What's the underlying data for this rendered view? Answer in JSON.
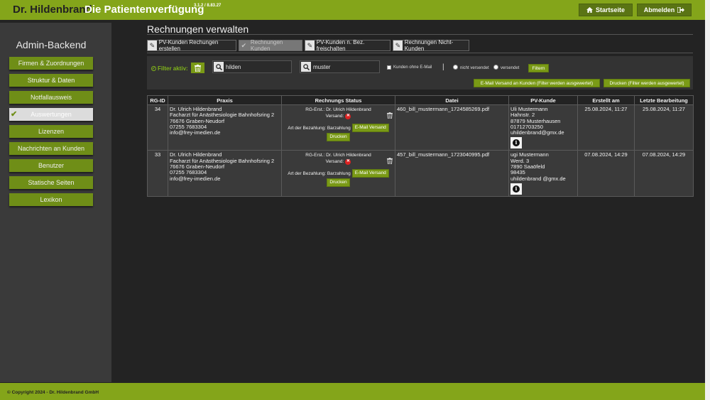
{
  "header": {
    "brand": "Dr. Hildenbrand",
    "app_name": "Die Patientenverfügung",
    "version": "3.1.2 / 8.83.27",
    "start_label": "Startseite",
    "logout_label": "Abmelden",
    "accent_color": "#84a51a"
  },
  "sidebar": {
    "title": "Admin-Backend",
    "items": [
      {
        "label": "Firmen & Zuordnungen"
      },
      {
        "label": "Struktur & Daten"
      },
      {
        "label": "Notfallausweis"
      },
      {
        "label": "Auswertungen",
        "active": true
      },
      {
        "label": "Lizenzen"
      },
      {
        "label": "Nachrichten an Kunden"
      },
      {
        "label": "Benutzer"
      },
      {
        "label": "Statische Seiten"
      },
      {
        "label": "Lexikon"
      }
    ]
  },
  "main": {
    "title": "Rechnungen verwalten",
    "tabs": [
      {
        "label": "PV-Kunden Rechungen erstellen"
      },
      {
        "label": "Rechnungen Kunden",
        "active": true
      },
      {
        "label": "PV-Kunden n. Bez. freischalten"
      },
      {
        "label": "Rechnungen Nicht-Kunden"
      }
    ]
  },
  "filter": {
    "label": "Filter aktiv:",
    "search1_value": "hilden",
    "search2_value": "muster",
    "no_email_label": "Kunden ohne E-Mail",
    "separator": "|",
    "not_sent_label": "nicht versendet",
    "sent_label": "versendet",
    "filter_button": "Filtern",
    "mail_all_button": "E-Mail Versand an Kunden (Filter werden ausgewertet)",
    "print_button": "Drucken (Filter werden ausgewertet)"
  },
  "table": {
    "headers": [
      "RG-ID",
      "Praxis",
      "Rechnungs Status",
      "Datei",
      "PV-Kunde",
      "Erstellt am",
      "Letzte Bearbeitung"
    ],
    "rows": [
      {
        "id": "34",
        "praxis": [
          "Dr. Ulrich Hildenbrand",
          "Facharzt für Anästhesiologie Bahnhofsring 2",
          "76676 Graben-Neudorf",
          "07255 7683304",
          "info@frey-imedien.de"
        ],
        "creator": "RG-Erst.: Dr. Ulrich Hildenbrand",
        "sent_label": "Versand:",
        "payment": "Art der Bezahlung: Barzahlung",
        "email_btn": "E-Mail Versand",
        "print_btn": "Drucken",
        "file": "460_bill_mustermann_1724585269.pdf",
        "customer": [
          "Uli Mustermann",
          "Hahnstr. 2",
          "87879 Musterhausen",
          "01712703250",
          "uhildenbrand@gmx.de"
        ],
        "created": "25.08.2024, 11:27",
        "edited": "25.08.2024, 11:27"
      },
      {
        "id": "33",
        "praxis": [
          "Dr. Ulrich Hildenbrand",
          "Facharzt für Anästhesiologie Bahnhofsring 2",
          "76676 Graben-Neudorf",
          "07255 7683304",
          "info@frey-imedien.de"
        ],
        "creator": "RG-Erst.: Dr. Ulrich Hildenbrand",
        "sent_label": "Versand:",
        "payment": "Art der Bezahlung: Barzahlung",
        "email_btn": "E-Mail Versand",
        "print_btn": "Drucken",
        "file": "457_bill_mustermann_1723040995.pdf",
        "customer": [
          "ugi Mustermann",
          "Werd. 3",
          "7890 Saaöfeld",
          "98435",
          "uhildenbrand @gmx.de"
        ],
        "created": "07.08.2024, 14:29",
        "edited": "07.08.2024, 14:29"
      }
    ]
  },
  "footer": {
    "copyright": "© Copyright 2024 - Dr. Hildenbrand GmbH"
  }
}
